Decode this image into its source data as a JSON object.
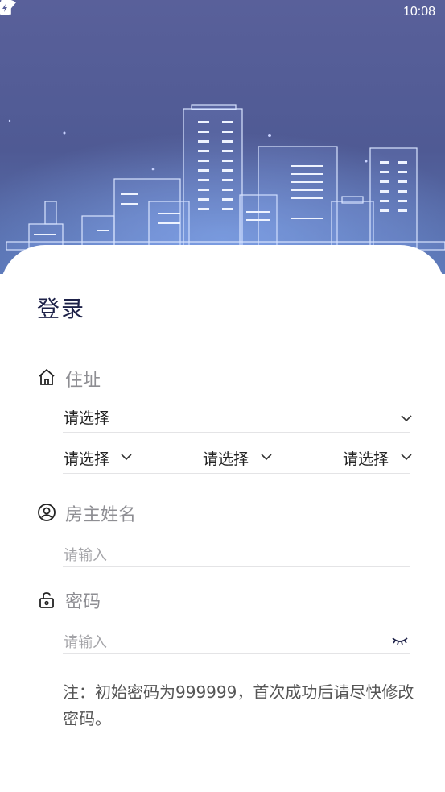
{
  "status_bar": {
    "time": "10:08",
    "icons": [
      "wifi-icon",
      "no-sim-icon",
      "battery-charging-icon"
    ]
  },
  "hero": {
    "illustration": "city-skyline"
  },
  "login": {
    "title": "登录",
    "address": {
      "label": "住址",
      "icon": "home-icon",
      "primary_select": "请选择",
      "sub_selects": [
        "请选择",
        "请选择",
        "请选择"
      ]
    },
    "owner_name": {
      "label": "房主姓名",
      "icon": "user-circle-icon",
      "placeholder": "请输入"
    },
    "password": {
      "label": "密码",
      "icon": "lock-icon",
      "placeholder": "请输入",
      "toggle_icon": "eye-closed-icon"
    },
    "note": "注：初始密码为999999，首次成功后请尽快修改密码。"
  },
  "colors": {
    "hero_bg": "#59609a",
    "title": "#1d2148",
    "label": "#8e8e93",
    "divider": "#e4e4e6"
  }
}
